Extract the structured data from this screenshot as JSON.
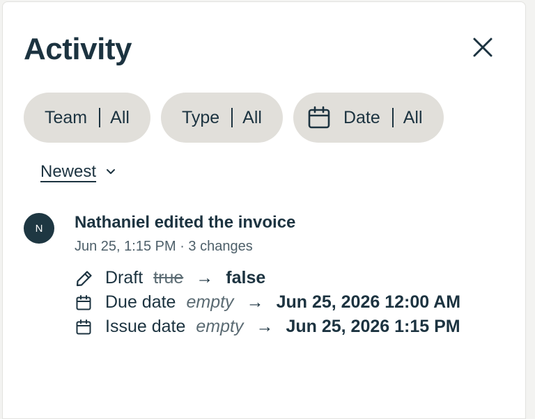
{
  "panel": {
    "title": "Activity"
  },
  "filters": [
    {
      "label": "Team",
      "value": "All"
    },
    {
      "label": "Type",
      "value": "All"
    },
    {
      "label": "Date",
      "value": "All"
    }
  ],
  "sort": {
    "label": "Newest"
  },
  "entry": {
    "avatar_initial": "N",
    "title": "Nathaniel edited the invoice",
    "meta": "Jun 25, 1:15 PM · 3 changes",
    "changes": [
      {
        "field": "Draft",
        "old": "true",
        "arrow": "→",
        "new": "false",
        "icon": "pencil-icon"
      },
      {
        "field": "Due date",
        "old": "empty",
        "arrow": "→",
        "new": "Jun 25, 2026 12:00 AM",
        "icon": "calendar-icon"
      },
      {
        "field": "Issue date",
        "old": "empty",
        "arrow": "→",
        "new": "Jun 25, 2026 1:15 PM",
        "icon": "calendar-icon"
      }
    ]
  },
  "colors": {
    "text": "#1c3340",
    "pill_bg": "#e1dfda",
    "avatar_bg": "#1e3742",
    "muted": "#4d5f69"
  }
}
